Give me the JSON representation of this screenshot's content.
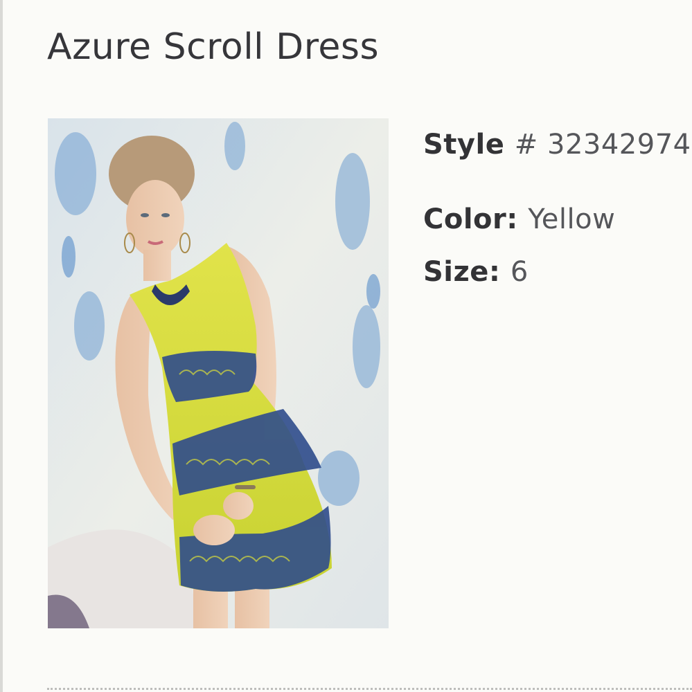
{
  "product": {
    "title": "Azure Scroll Dress",
    "image_alt": "Model wearing the yellow and blue scroll-print sheath dress"
  },
  "details": {
    "style_label": "Style",
    "style_value": "# 32342974",
    "color_label": "Color:",
    "color_value": "Yellow",
    "size_label": "Size:",
    "size_value": "6"
  },
  "colors": {
    "background": "#fbfbf8",
    "text": "#36363a",
    "dress_yellow": "#d8dc3a",
    "dress_blue": "#2f4c8c"
  }
}
